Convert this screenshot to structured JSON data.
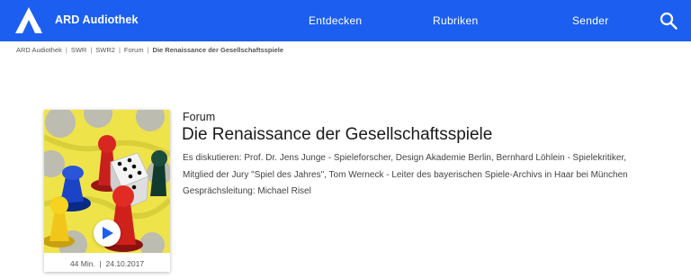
{
  "header": {
    "brand": "ARD Audiothek",
    "nav": [
      "Entdecken",
      "Rubriken",
      "Sender"
    ],
    "icons": {
      "logo": "ard-logo",
      "search": "search-icon"
    },
    "colors": {
      "bar": "#1c5ff0",
      "text": "#ffffff"
    }
  },
  "breadcrumb": {
    "items": [
      "ARD Audiothek",
      "SWR",
      "SWR2",
      "Forum"
    ],
    "current": "Die Renaissance der Gesellschaftsspiele"
  },
  "episode": {
    "show": "Forum",
    "title": "Die Renaissance der Gesellschaftsspiele",
    "description_lines": [
      "Es diskutieren: Prof. Dr. Jens Junge - Spieleforscher, Design Akademie Berlin, Bernhard Löhlein - Spielekritiker,",
      "Mitglied der Jury \"Spiel des Jahres\", Tom Werneck - Leiter des bayerischen Spiele-Archivs in Haar bei München",
      "Gesprächsleitung: Michael Risel"
    ],
    "duration": "44 Min.",
    "date": "24.10.2017",
    "play_icon": "play-icon"
  }
}
